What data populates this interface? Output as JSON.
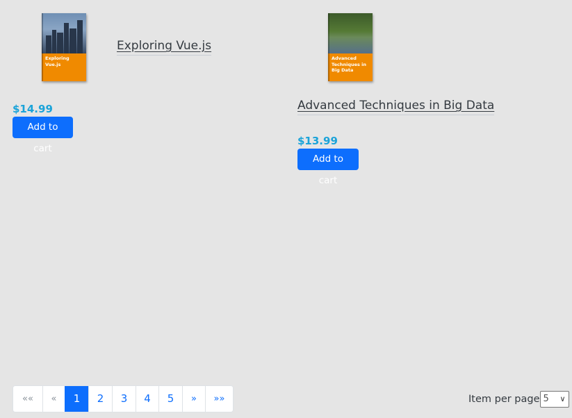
{
  "products": [
    {
      "title": "Exploring Vue.js",
      "cover_title": "Exploring Vue.js",
      "price": "$14.99",
      "button_label": "Add to cart"
    },
    {
      "title": "Advanced Techniques in Big Data",
      "cover_title": "Advanced Techniques in Big Data",
      "price": "$13.99",
      "button_label": "Add to cart"
    }
  ],
  "pagination": {
    "first": "««",
    "prev": "«",
    "pages": [
      "1",
      "2",
      "3",
      "4",
      "5"
    ],
    "active_page": "1",
    "next": "»",
    "last": "»»"
  },
  "items_per_page": {
    "label": "Item per page",
    "selected": "5"
  },
  "colors": {
    "accent": "#0d6efd",
    "price": "#1aa3d9",
    "background": "#e5e5e5",
    "cover": "#f08a00"
  }
}
